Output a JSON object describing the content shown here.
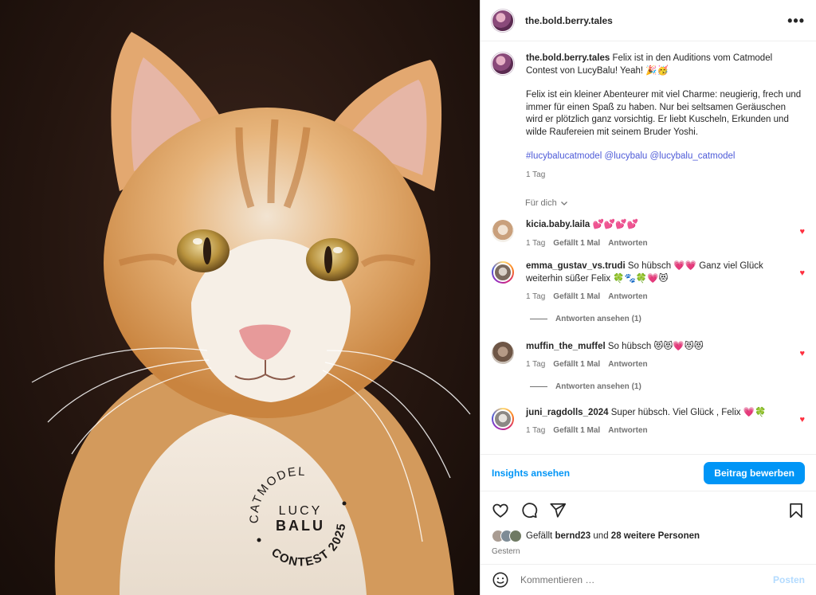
{
  "post": {
    "username": "the.bold.berry.tales",
    "more_label": "•••"
  },
  "photo": {
    "seal_top": "CATMODEL",
    "seal_lucy": "LUCY",
    "seal_balu": "BALU",
    "seal_bottom": "CONTEST 2025"
  },
  "caption": {
    "username": "the.bold.berry.tales",
    "line1": "Felix ist in den Auditions vom Catmodel Contest von LucyBalu! Yeah! 🎉🥳",
    "line2": "Felix ist ein kleiner Abenteurer mit viel Charme: neugierig, frech und immer für einen Spaß zu haben. Nur bei seltsamen Geräuschen wird er plötzlich ganz vorsichtig. Er liebt Kuscheln, Erkunden und wilde Raufereien mit seinem Bruder Yoshi.",
    "tags": "#lucybalucatmodel @lucybalu @lucybalu_catmodel",
    "time": "1 Tag"
  },
  "filter_label": "Für dich",
  "comments": [
    {
      "user": "kicia.baby.laila",
      "text": "💕💕💕💕",
      "time": "1 Tag",
      "likes": "Gefällt 1 Mal",
      "reply": "Antworten"
    },
    {
      "user": "emma_gustav_vs.trudi",
      "text": "So hübsch 💗💗 Ganz viel Glück weiterhin süßer Felix 🍀🐾🍀💗😻",
      "time": "1 Tag",
      "likes": "Gefällt 1 Mal",
      "reply": "Antworten",
      "view_replies": "Antworten ansehen (1)"
    },
    {
      "user": "muffin_the_muffel",
      "text": "So hübsch 😻😻💗😻😻",
      "time": "1 Tag",
      "likes": "Gefällt 1 Mal",
      "reply": "Antworten",
      "view_replies": "Antworten ansehen (1)"
    },
    {
      "user": "juni_ragdolls_2024",
      "text": "Super hübsch. Viel Glück , Felix 💗🍀",
      "time": "1 Tag",
      "likes": "Gefällt 1 Mal",
      "reply": "Antworten"
    }
  ],
  "insights_label": "Insights ansehen",
  "promote_label": "Beitrag bewerben",
  "likes": {
    "prefix": "Gefällt",
    "user": "bernd23",
    "middle": "und",
    "others": "28 weitere Personen"
  },
  "date_label": "Gestern",
  "comment_input": {
    "placeholder": "Kommentieren …",
    "post_label": "Posten"
  },
  "colors": {
    "accent": "#0095f6",
    "heart": "#ff3040",
    "hashtag": "#4e5bd8"
  },
  "icons": [
    "heart-icon",
    "comment-icon",
    "share-icon",
    "bookmark-icon",
    "emoji-icon",
    "chevron-down-icon",
    "more-icon"
  ]
}
